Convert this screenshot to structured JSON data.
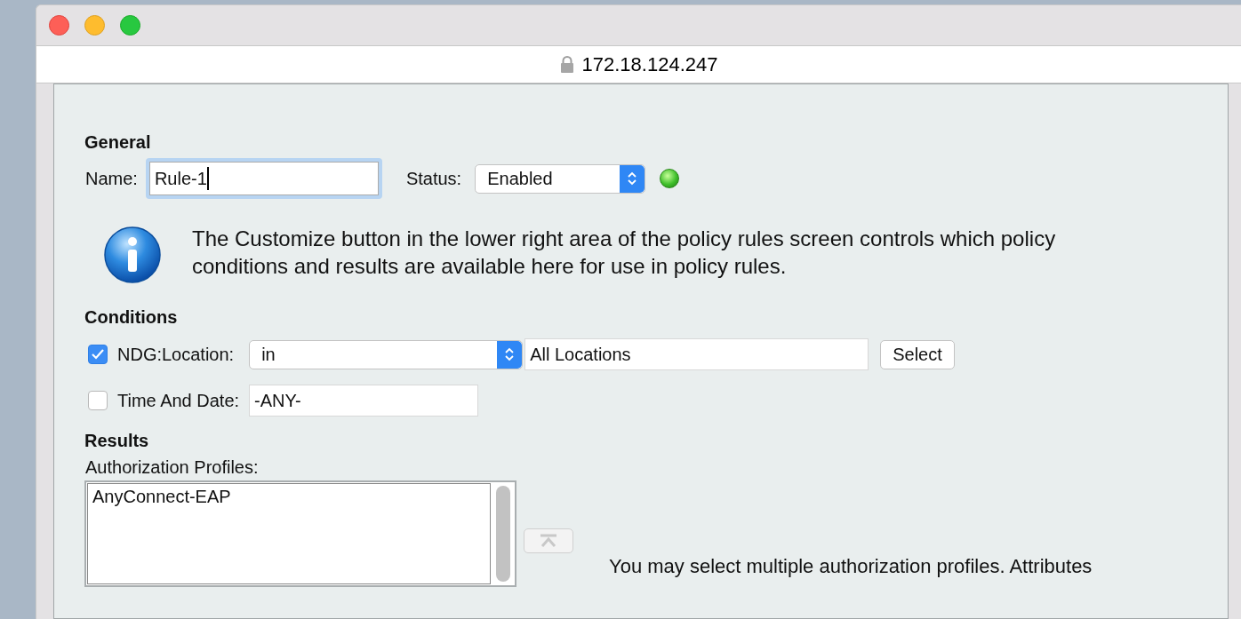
{
  "address_bar": {
    "url": "172.18.124.247",
    "secure": true
  },
  "general": {
    "heading": "General",
    "name_label": "Name:",
    "name_value": "Rule-1",
    "status_label": "Status:",
    "status_value": "Enabled",
    "status_on": true
  },
  "info": {
    "text": "The Customize button in the lower right area of the policy rules screen controls which policy conditions and results are available here for use in policy rules."
  },
  "conditions": {
    "heading": "Conditions",
    "rows": [
      {
        "kind": "select",
        "checked": true,
        "label": "NDG:Location:",
        "operator": "in",
        "value": "All Locations",
        "button": "Select"
      },
      {
        "kind": "plain",
        "checked": false,
        "label": "Time And Date:",
        "value": "-ANY-"
      }
    ]
  },
  "results": {
    "heading": "Results",
    "profiles_label": "Authorization Profiles:",
    "profiles": [
      "AnyConnect-EAP"
    ],
    "note": "You may select multiple authorization profiles. Attributes"
  }
}
